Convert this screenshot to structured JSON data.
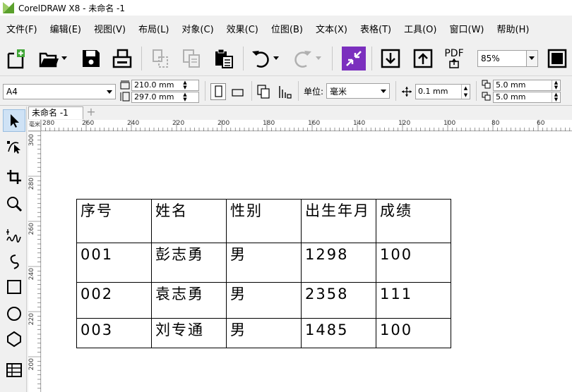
{
  "window": {
    "title": "CorelDRAW X8 - 未命名 -1"
  },
  "menu": [
    "文件(F)",
    "编辑(E)",
    "视图(V)",
    "布局(L)",
    "对象(C)",
    "效果(C)",
    "位图(B)",
    "文本(X)",
    "表格(T)",
    "工具(O)",
    "窗口(W)",
    "帮助(H)"
  ],
  "toolbar": {
    "zoom": "85%",
    "pdf_label": "PDF"
  },
  "property_bar": {
    "page_size": "A4",
    "width": "210.0 mm",
    "height": "297.0 mm",
    "units_label": "单位:",
    "units_value": "毫米",
    "nudge": "0.1 mm",
    "dup_x": "5.0 mm",
    "dup_y": "5.0 mm"
  },
  "document_tab": "未命名 -1",
  "ruler": {
    "unit": "毫米",
    "h_ticks": [
      "280",
      "260",
      "240",
      "220",
      "200",
      "180",
      "160",
      "140",
      "120",
      "100",
      "80",
      "60"
    ],
    "v_ticks": [
      "300",
      "280",
      "260",
      "240",
      "220",
      "200"
    ]
  },
  "table": {
    "rows": [
      [
        "序号",
        "姓名",
        "性别",
        "出生年月",
        "成绩"
      ],
      [
        "001",
        "彭志勇",
        "男",
        "1298",
        "100"
      ],
      [
        "002",
        "袁志勇",
        "男",
        "2358",
        "111"
      ],
      [
        "003",
        "刘专通",
        "男",
        "1485",
        "100"
      ]
    ]
  },
  "colors": {
    "accent_purple": "#7b2fbe",
    "logo_green": "#5aa02c"
  }
}
